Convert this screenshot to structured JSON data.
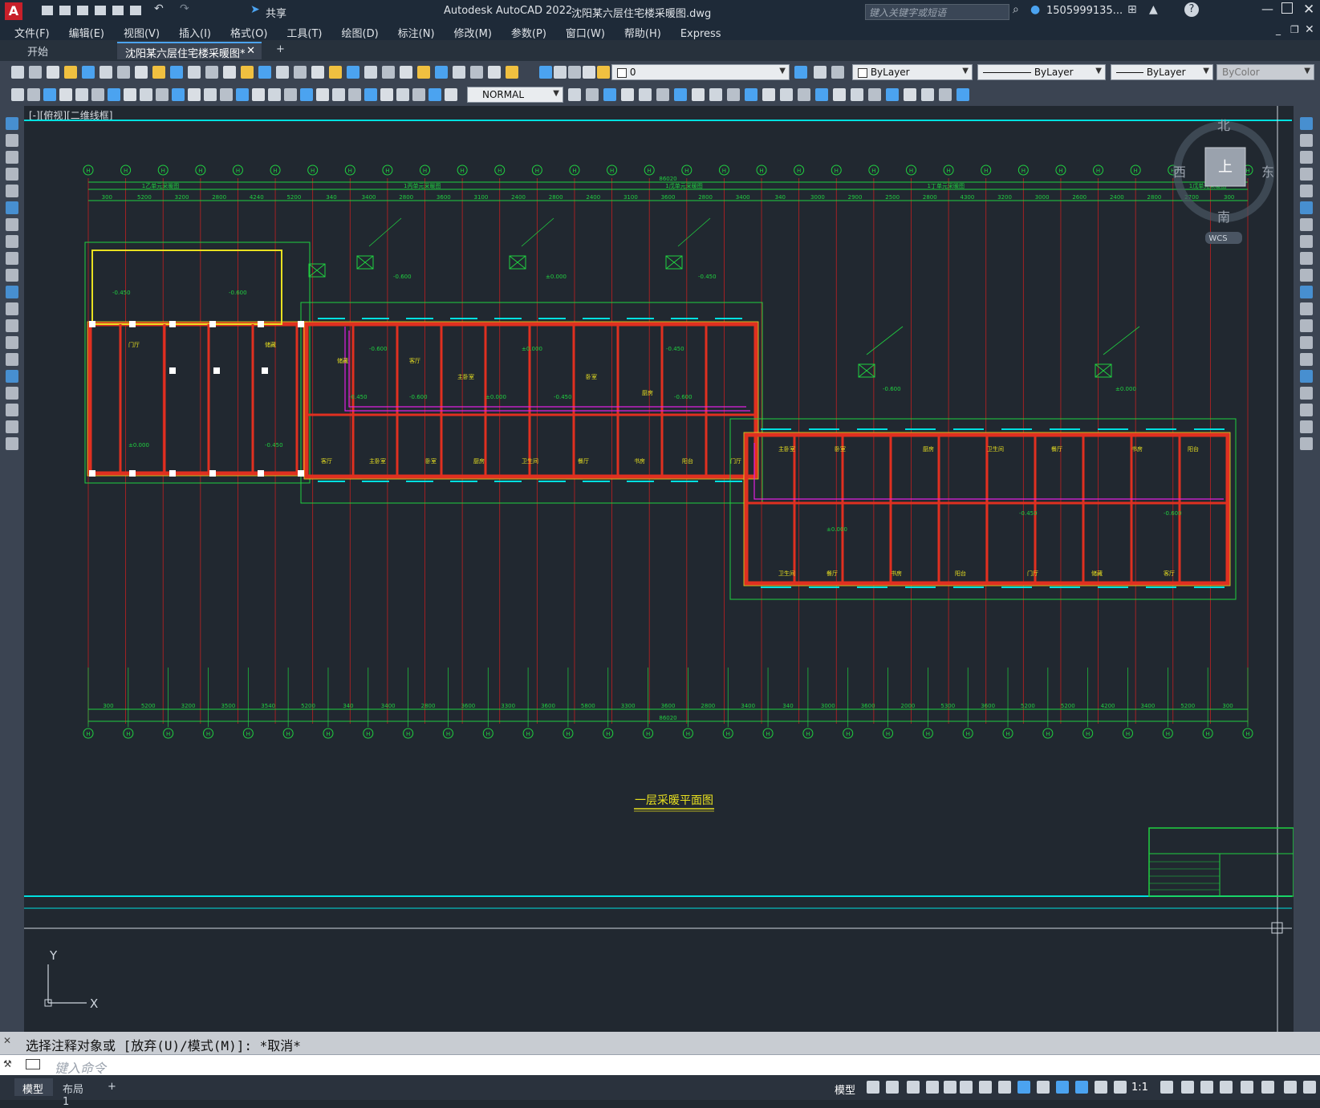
{
  "app": {
    "title": "Autodesk AutoCAD 2022",
    "document_title": "沈阳某六层住宅楼采暖图.dwg",
    "logo_letter": "A",
    "share_label": "共享",
    "search_placeholder": "键入关键字或短语",
    "user_label": "1505999135..."
  },
  "menu": {
    "items": [
      "文件(F)",
      "编辑(E)",
      "视图(V)",
      "插入(I)",
      "格式(O)",
      "工具(T)",
      "绘图(D)",
      "标注(N)",
      "修改(M)",
      "参数(P)",
      "窗口(W)",
      "帮助(H)",
      "Express"
    ]
  },
  "tabs": {
    "start_label": "开始",
    "active_label": "沈阳某六层住宅楼采暖图*",
    "add_label": "+"
  },
  "properties": {
    "layer_value": "0",
    "color_value": "ByLayer",
    "linetype_value": "ByLayer",
    "lineweight_value": "ByLayer",
    "plotstyle_value": "ByColor",
    "dimstyle_value": "NORMAL"
  },
  "viewport": {
    "view_label": "[-][俯视][二维线框]",
    "compass": {
      "north": "北",
      "south": "南",
      "east": "东",
      "west": "西",
      "top": "上",
      "wcs": "WCS"
    },
    "drawing_title": "一层采暖平面图",
    "ucs_x": "X",
    "ucs_y": "Y",
    "overall_dim_top": "86020",
    "overall_dim_bottom": "86020",
    "top_dims": [
      "300",
      "5200",
      "3200",
      "2800",
      "4240",
      "5200",
      "340",
      "3400",
      "2800",
      "3600",
      "3100",
      "2400",
      "2800",
      "2400",
      "3100",
      "3600",
      "2800",
      "3400",
      "340",
      "3000",
      "2900",
      "2500",
      "2800",
      "4300",
      "3200",
      "3000",
      "2600",
      "2400",
      "2800",
      "2700",
      "300"
    ],
    "bottom_dims": [
      "300",
      "5200",
      "3200",
      "3500",
      "3540",
      "5200",
      "340",
      "3400",
      "2800",
      "3600",
      "3300",
      "3600",
      "5800",
      "3300",
      "3600",
      "2800",
      "3400",
      "340",
      "3000",
      "3600",
      "2000",
      "5300",
      "3600",
      "5200",
      "5200",
      "4200",
      "3400",
      "5200",
      "300"
    ],
    "segment_labels": [
      "1乙单元采暖图",
      "1丙单元采暖图",
      "1戊单元采暖图",
      "1丁单元采暖图",
      "1戊单元采暖图"
    ],
    "rooms": [
      "客厅",
      "主卧室",
      "卧室",
      "厨房",
      "卫生间",
      "餐厅",
      "书房",
      "阳台",
      "门厅",
      "储藏"
    ],
    "levels": [
      "-0.450",
      "-0.600",
      "±0.000"
    ],
    "axis_label": "H"
  },
  "command": {
    "history": "选择注释对象或 [放弃(U)/模式(M)]: *取消*",
    "placeholder": "键入命令"
  },
  "status": {
    "model_tab": "模型",
    "layout_tab": "布局1",
    "add_tab": "+",
    "model_button": "模型",
    "scale_label": "1:1"
  },
  "colors": {
    "background": "#212830",
    "wall": "#e03020",
    "dim": "#20d040",
    "cyan": "#00e0e0",
    "magenta": "#e020e0",
    "yellow": "#e8e020"
  }
}
